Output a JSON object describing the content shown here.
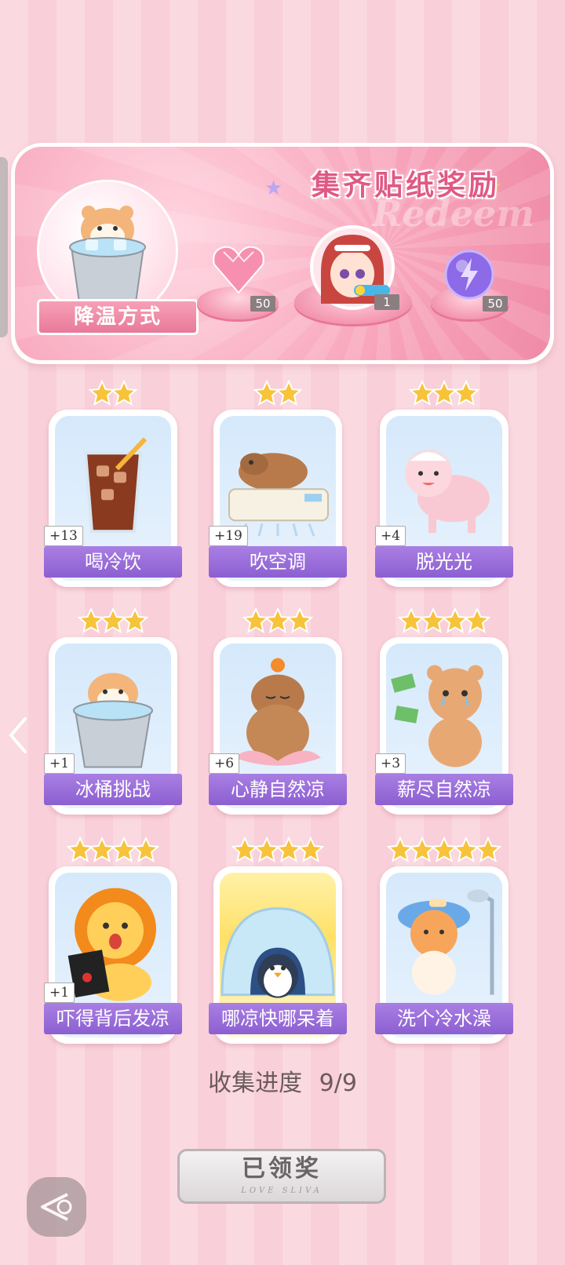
{
  "banner": {
    "title": "集齐贴纸奖励",
    "watermark": "Redeem",
    "ribbon_label": "降温方式",
    "rewards": [
      {
        "icon": "pink-heart-gem-icon",
        "count": "50"
      },
      {
        "icon": "red-hair-girl-avatar-icon",
        "count": "1"
      },
      {
        "icon": "purple-lightning-orb-icon",
        "count": "50"
      }
    ]
  },
  "cards": [
    {
      "label": "喝冷饮",
      "plus": "+13",
      "stars": 2,
      "icon": "iced-cola-icon"
    },
    {
      "label": "吹空调",
      "plus": "+19",
      "stars": 2,
      "icon": "capybara-on-aircon-icon"
    },
    {
      "label": "脱光光",
      "plus": "+4",
      "stars": 3,
      "icon": "sheared-sheep-icon"
    },
    {
      "label": "冰桶挑战",
      "plus": "+1",
      "stars": 3,
      "icon": "hamster-ice-bucket-icon"
    },
    {
      "label": "心静自然凉",
      "plus": "+6",
      "stars": 3,
      "icon": "meditating-capybara-icon"
    },
    {
      "label": "薪尽自然凉",
      "plus": "+3",
      "stars": 4,
      "icon": "crying-bear-icon"
    },
    {
      "label": "吓得背后发凉",
      "plus": "+1",
      "stars": 4,
      "icon": "scared-lion-icon"
    },
    {
      "label": "哪凉快哪呆着",
      "plus": "",
      "stars": 4,
      "icon": "penguin-igloo-icon"
    },
    {
      "label": "洗个冷水澡",
      "plus": "",
      "stars": 5,
      "icon": "cat-shower-icon"
    }
  ],
  "progress": {
    "label": "收集进度",
    "value": "9/9"
  },
  "claim": {
    "label": "已领奖",
    "sub": "LOVE SLIVA"
  },
  "colors": {
    "accent_pink": "#e05985",
    "label_purple": "#8c5fd1",
    "star_gold": "#f7c33a"
  }
}
